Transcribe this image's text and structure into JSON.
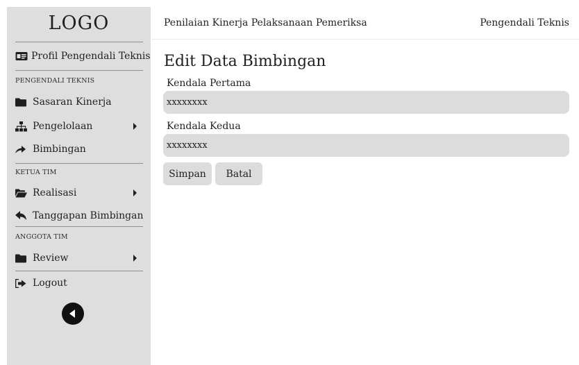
{
  "sidebar": {
    "logo": "LOGO",
    "profile": {
      "label": "Profil Pengendali Teknis",
      "icon": "id-card-icon"
    },
    "sections": [
      {
        "label": "PENGENDALI TEKNIS",
        "items": [
          {
            "label": "Sasaran Kinerja",
            "icon": "folder-icon"
          },
          {
            "label": "Pengelolaan",
            "icon": "sitemap-icon",
            "has_submenu": true
          },
          {
            "label": "Bimbingan",
            "icon": "share-arrow-icon"
          }
        ]
      },
      {
        "label": "KETUA TIM",
        "items": [
          {
            "label": "Realisasi",
            "icon": "folder-open-icon",
            "has_submenu": true
          },
          {
            "label": "Tanggapan Bimbingan",
            "icon": "reply-icon"
          }
        ]
      },
      {
        "label": "ANGGOTA TIM",
        "items": [
          {
            "label": "Review",
            "icon": "folder-icon",
            "has_submenu": true
          }
        ]
      }
    ],
    "logout": {
      "label": "Logout",
      "icon": "sign-in-icon"
    },
    "collapse_icon": "back-circle-icon"
  },
  "header": {
    "title": "Penilaian Kinerja Pelaksanaan Pemeriksa",
    "role": "Pengendali Teknis"
  },
  "form": {
    "title": "Edit Data Bimbingan",
    "fields": [
      {
        "label": "Kendala Pertama",
        "value": "xxxxxxxx"
      },
      {
        "label": "Kendala Kedua",
        "value": "xxxxxxxx"
      }
    ],
    "save_label": "Simpan",
    "cancel_label": "Batal"
  },
  "colors": {
    "sidebar_bg": "#dedede",
    "field_bg": "#dcdcdc",
    "text": "#1f1f1f"
  }
}
